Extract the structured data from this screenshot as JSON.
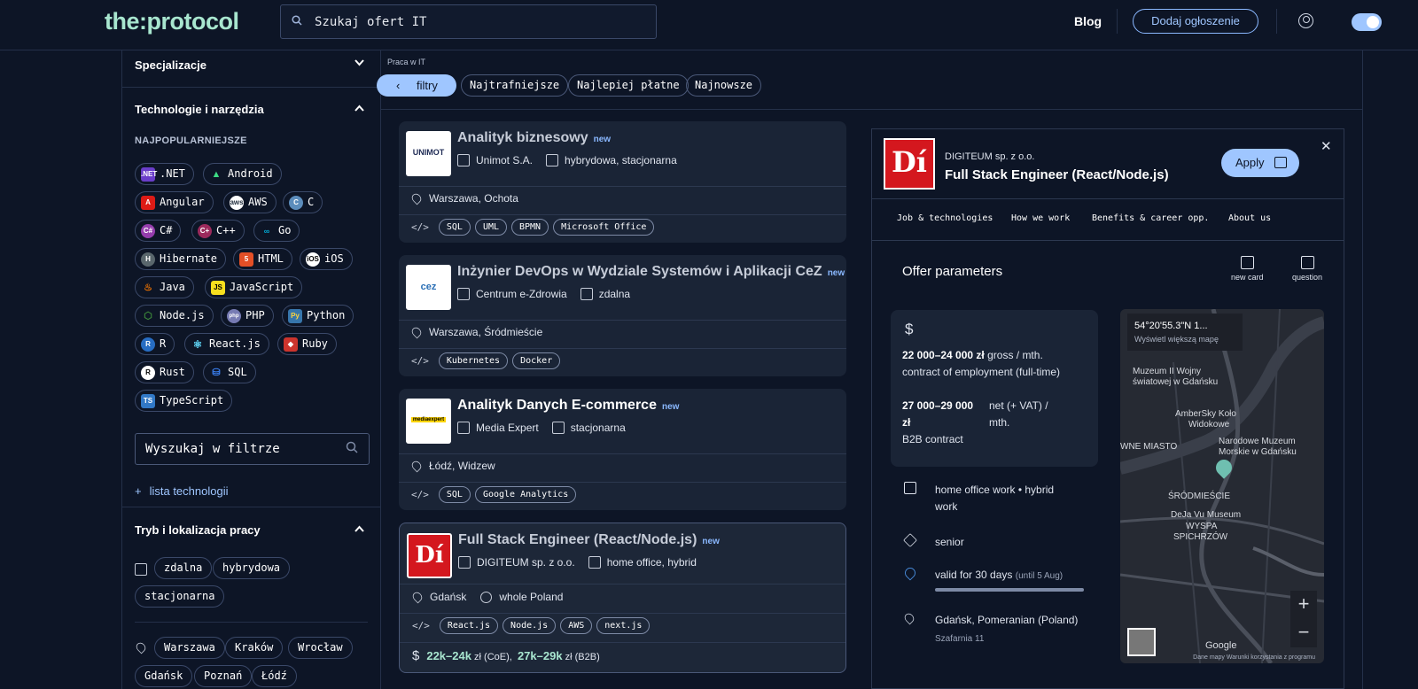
{
  "header": {
    "logo_a": "the",
    "logo_b": ":protocol",
    "search_placeholder": "Szukaj ofert IT",
    "blog": "Blog",
    "add_offer": "Dodaj ogłoszenie"
  },
  "sidebar": {
    "specializations": "Specjalizacje",
    "technologies": "Technologie i narzędzia",
    "popular": "NAJPOPULARNIEJSZE",
    "tech_chips": [
      ".NET",
      "Android",
      "Angular",
      "AWS",
      "C",
      "C#",
      "C++",
      "Go",
      "Hibernate",
      "HTML",
      "iOS",
      "Java",
      "JavaScript",
      "Node.js",
      "PHP",
      "Python",
      "R",
      "React.js",
      "Ruby",
      "Rust",
      "SQL",
      "TypeScript"
    ],
    "filter_search": "Wyszukaj w filtrze",
    "list_tech": "lista technologii",
    "work_mode": "Tryb i lokalizacja pracy",
    "modes": [
      "zdalna",
      "hybrydowa",
      "stacjonarna"
    ],
    "cities": [
      "Warszawa",
      "Kraków",
      "Wrocław",
      "Gdańsk",
      "Poznań",
      "Łódź"
    ]
  },
  "main": {
    "breadcrumb": "Praca w IT",
    "filters_btn": "filtry",
    "sort": [
      "Najtrafniejsze",
      "Najlepiej płatne",
      "Najnowsze"
    ]
  },
  "jobs": [
    {
      "title": "Analityk biznesowy",
      "new": "new",
      "company": "Unimot S.A.",
      "mode": "hybrydowa, stacjonarna",
      "location": "Warszawa, Ochota",
      "tags": [
        "SQL",
        "UML",
        "BPMN",
        "Microsoft Office"
      ],
      "logo_text": "UNIMOT"
    },
    {
      "title": "Inżynier DevOps w Wydziale Systemów i Aplikacji CeZ",
      "new": "new",
      "company": "Centrum e-Zdrowia",
      "mode": "zdalna",
      "location": "Warszawa, Śródmieście",
      "tags": [
        "Kubernetes",
        "Docker"
      ],
      "logo_text": "cez"
    },
    {
      "title": "Analityk Danych E-commerce",
      "new": "new",
      "company": "Media Expert",
      "mode": "stacjonarna",
      "location": "Łódź, Widzew",
      "tags": [
        "SQL",
        "Google Analytics"
      ],
      "logo_text": "mediaexpert"
    },
    {
      "title": "Full Stack Engineer (React/Node.js)",
      "new": "new",
      "company": "DIGITEUM sp. z o.o.",
      "mode": "home office, hybrid",
      "location": "Gdańsk",
      "location2": "whole Poland",
      "tags": [
        "React.js",
        "Node.js",
        "AWS",
        "next.js"
      ],
      "salary_coe": "22k–24k",
      "salary_coe_suffix": "zł (CoE),",
      "salary_b2b": "27k–29k",
      "salary_b2b_suffix": "zł (B2B)",
      "logo_text": "Dí"
    }
  ],
  "detail": {
    "company": "DIGITEUM sp. z o.o.",
    "title": "Full Stack Engineer (React/Node.js)",
    "apply": "Apply",
    "tabs": [
      "Job & technologies",
      "How we work",
      "Benefits & career opp.",
      "About us"
    ],
    "offer_params": "Offer parameters",
    "new_card": "new card",
    "question": "question",
    "salary1_amount": "22 000–24 000 zł",
    "salary1_tail": "gross / mth.",
    "salary1_type": "contract of employment (full-time)",
    "salary2_amount_a": "27 000–29 000",
    "salary2_amount_b": "zł",
    "salary2_tail_a": "net (+ VAT) /",
    "salary2_tail_b": "mth.",
    "salary2_type": "B2B contract",
    "work_a": "home office work • hybrid",
    "work_b": "work",
    "level": "senior",
    "valid": "valid for 30 days",
    "valid_until": "(until 5 Aug)",
    "location": "Gdańsk, Pomeranian (Poland)",
    "street": "Szafarnia 11",
    "map_coord": "54°20'55.3\"N 1...",
    "map_larger": "Wyświetl większą mapę",
    "map_labels": [
      "Muzeum II Wojny",
      "światowej w Gdańsku",
      "AmberSky Koło",
      "Widokowe",
      "WNE MIASTO",
      "Narodowe Muzeum",
      "Morskie w Gdańsku",
      "ŚRÓDMIEŚCIE",
      "DeJa Vu Museum",
      "WYSPA",
      "SPICHRZÓW",
      "Google"
    ],
    "map_footer": "Dane mapy   Warunki korzystania z programu"
  }
}
